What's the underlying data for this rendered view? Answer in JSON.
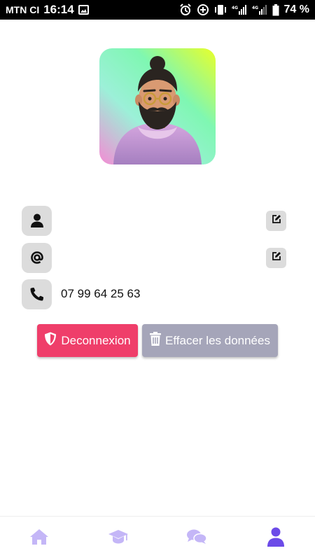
{
  "status_bar": {
    "carrier": "MTN CI",
    "time": "16:14",
    "network_label": "4G",
    "battery": "74 %"
  },
  "profile": {
    "name": "",
    "email": "",
    "phone": "07 99 64 25 63"
  },
  "actions": {
    "logout_label": "Deconnexion",
    "clear_label": "Effacer les données"
  },
  "nav": {
    "items": [
      {
        "icon": "home-icon",
        "active": false
      },
      {
        "icon": "graduation-cap-icon",
        "active": false
      },
      {
        "icon": "chat-icon",
        "active": false
      },
      {
        "icon": "user-icon",
        "active": true
      }
    ]
  },
  "colors": {
    "logout": "#ef3e6a",
    "clear": "#a5a5b9",
    "nav_inactive": "#c4b6f7",
    "nav_active": "#6c4be8"
  }
}
